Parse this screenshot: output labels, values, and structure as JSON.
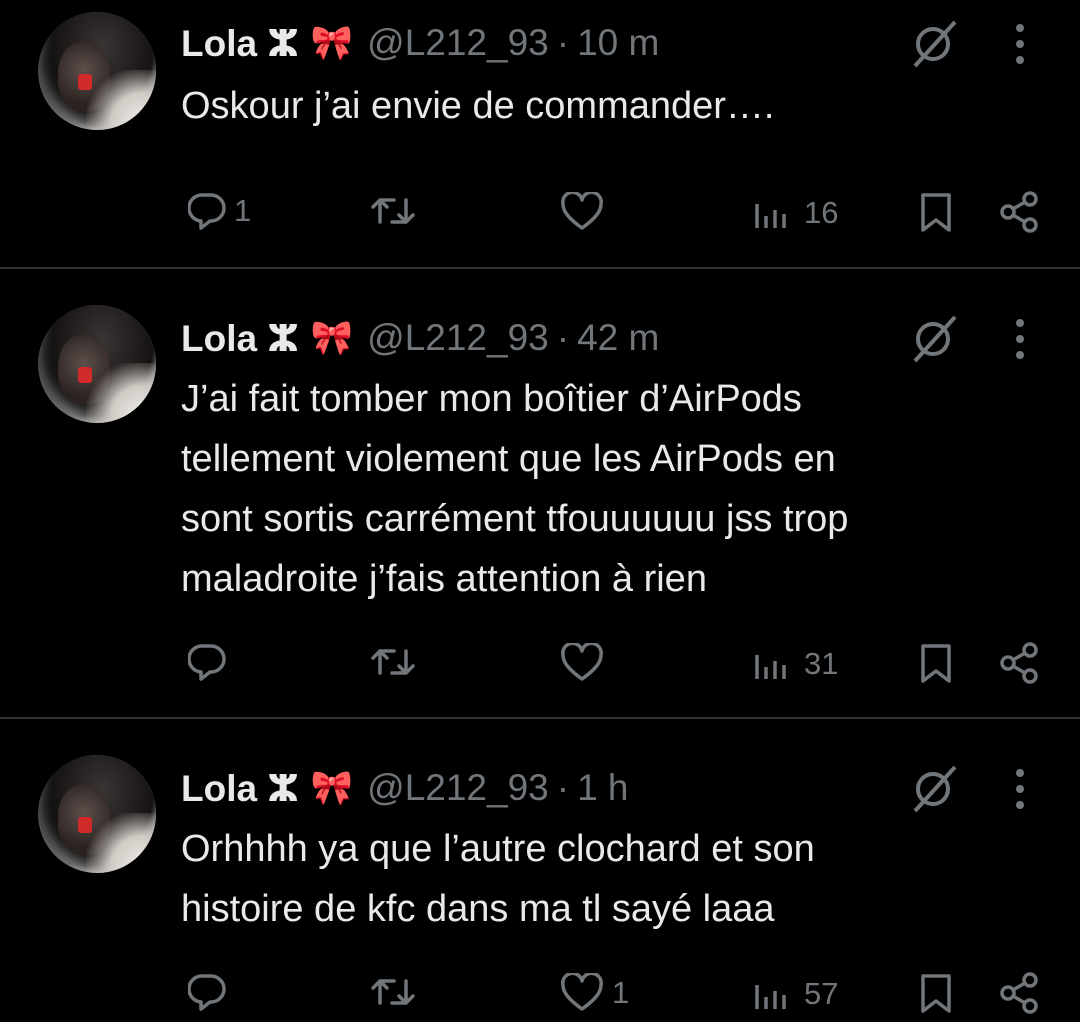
{
  "tweets": [
    {
      "name": "Lola ⵣ",
      "emoji": "🎀",
      "handle": "@L212_93",
      "separator": "·",
      "time": "10 m",
      "text": "Oskour j’ai envie de commander….",
      "replies": "1",
      "retweets": "",
      "likes": "",
      "views": "16"
    },
    {
      "name": "Lola ⵣ",
      "emoji": "🎀",
      "handle": "@L212_93",
      "separator": "·",
      "time": "42 m",
      "text": "J’ai fait tomber mon boîtier d’AirPods\ntellement violement que les AirPods en\nsont sortis carrément tfouuuuuu jss trop\nmaladroite j’fais attention à rien",
      "replies": "",
      "retweets": "",
      "likes": "",
      "views": "31"
    },
    {
      "name": "Lola ⵣ",
      "emoji": "🎀",
      "handle": "@L212_93",
      "separator": "·",
      "time": "1 h",
      "text": "Orhhhh ya que l’autre clochard et son\nhistoire de kfc dans ma tl sayé laaa",
      "replies": "",
      "retweets": "",
      "likes": "1",
      "views": "57"
    }
  ],
  "icons": {
    "reply": "reply-icon",
    "retweet": "retweet-icon",
    "like": "heart-icon",
    "views": "views-icon",
    "bookmark": "bookmark-icon",
    "share": "share-icon",
    "grok": "grok-icon",
    "more": "more-icon"
  },
  "colors": {
    "background": "#000000",
    "text": "#e7e9ea",
    "muted": "#71767b",
    "divider": "#2f3336"
  }
}
